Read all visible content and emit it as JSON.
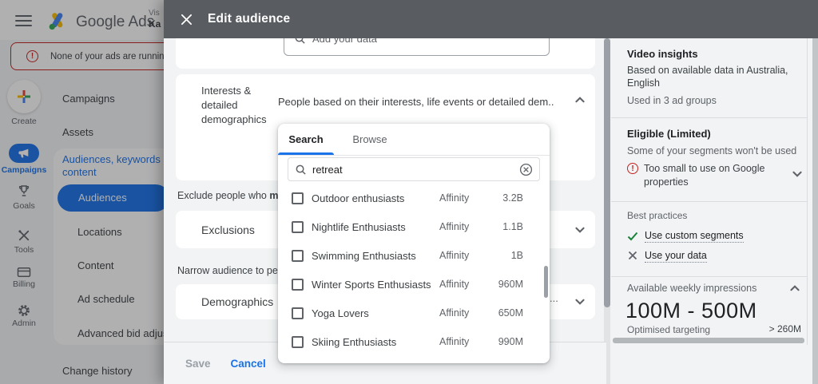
{
  "app": {
    "brand": "Google Ads",
    "account_line1": "Vis",
    "account_line2": "Ka",
    "warning_banner": "None of your ads are running - Yo",
    "rail": [
      {
        "label": "Create",
        "icon": "plus-icon"
      },
      {
        "label": "Campaigns",
        "icon": "megaphone-icon",
        "active": true
      },
      {
        "label": "Goals",
        "icon": "trophy-icon"
      },
      {
        "label": "Tools",
        "icon": "tools-icon"
      },
      {
        "label": "Billing",
        "icon": "billing-icon"
      },
      {
        "label": "Admin",
        "icon": "gear-icon"
      }
    ],
    "nav": {
      "items_top": [
        "Campaigns",
        "Assets"
      ],
      "group_label": "Audiences, keywords and content",
      "group_items": [
        "Audiences",
        "Locations",
        "Content",
        "Ad schedule",
        "Advanced bid adjustments"
      ],
      "active_item": "Audiences",
      "items_bottom": [
        "Change history"
      ]
    }
  },
  "modal": {
    "title": "Edit audience",
    "your_data_placeholder": "Add your data",
    "sections": {
      "interests": {
        "label": "Interests & detailed demographics",
        "description": "People based on their interests, life events or detailed dem..."
      },
      "exclude_prefix": "Exclude people who ",
      "exclude_bold": "match",
      "exclusions_label": "Exclusions",
      "narrow_text": "Narrow audience to people",
      "demographics_label": "Demographics",
      "demographics_truncated": "..."
    },
    "picker": {
      "tabs": [
        "Search",
        "Browse"
      ],
      "active_tab": "Search",
      "search_value": "retreat",
      "results": [
        {
          "name": "Outdoor enthusiasts",
          "type": "Affinity",
          "size": "3.2B"
        },
        {
          "name": "Nightlife Enthusiasts",
          "type": "Affinity",
          "size": "1.1B"
        },
        {
          "name": "Swimming Enthusiasts",
          "type": "Affinity",
          "size": "1B"
        },
        {
          "name": "Winter Sports Enthusiasts",
          "type": "Affinity",
          "size": "960M"
        },
        {
          "name": "Yoga Lovers",
          "type": "Affinity",
          "size": "650M"
        },
        {
          "name": "Skiing Enthusiasts",
          "type": "Affinity",
          "size": "990M"
        }
      ]
    },
    "footer": {
      "save": "Save",
      "cancel": "Cancel"
    }
  },
  "panel": {
    "video": {
      "title": "Video insights",
      "subtitle_lines": [
        "Based on available data in Australia,",
        "English"
      ],
      "usage": "Used in 3 ad groups"
    },
    "eligibility": {
      "title": "Eligible (Limited)",
      "subtitle": "Some of your segments won't be used",
      "warning_lines": [
        "Too small to use on Google",
        "properties"
      ]
    },
    "best_practices": {
      "title": "Best practices",
      "items": [
        {
          "label": "Use custom segments",
          "status": "check"
        },
        {
          "label": "Use your data",
          "status": "cross"
        }
      ]
    },
    "impressions": {
      "title": "Available weekly impressions",
      "range": "100M - 500M",
      "optimised_label": "Optimised targeting",
      "optimised_value": "> 260M"
    }
  },
  "colors": {
    "accent_blue": "#1a73e8",
    "header_gray": "#595d61",
    "warning_red": "#c5221f",
    "success_green": "#188038"
  },
  "icons": {
    "menu": "hamburger",
    "close": "x",
    "search": "magnifier",
    "clear": "circle-x",
    "warning": "circle-exclamation",
    "check": "checkmark",
    "cross": "x",
    "chevron_up": "^",
    "chevron_down": "v"
  }
}
